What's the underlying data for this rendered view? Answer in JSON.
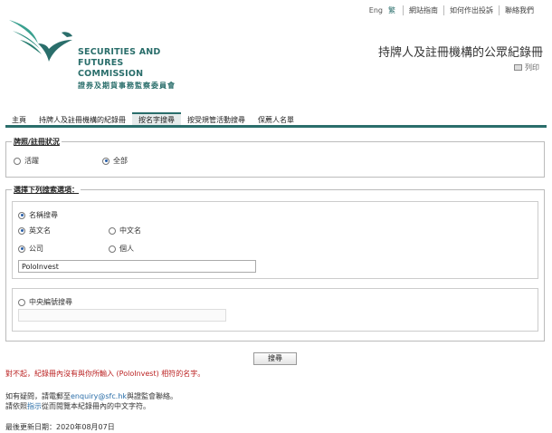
{
  "topnav": {
    "lang_en": "Eng",
    "lang_tc": "繁",
    "links": [
      "網站指南",
      "如何作出投訴",
      "聯絡我們"
    ]
  },
  "logo": {
    "line1": "SECURITIES AND",
    "line2": "FUTURES COMMISSION",
    "zh": "證券及期貨事務監察委員會"
  },
  "page_title": "持牌人及註冊機構的公眾紀錄冊",
  "print_label": "列印",
  "tabs": [
    {
      "label": "主頁",
      "active": false
    },
    {
      "label": "持牌人及註冊機構的紀錄冊",
      "active": false
    },
    {
      "label": "按名字搜尋",
      "active": true
    },
    {
      "label": "按受規管活動搜尋",
      "active": false
    },
    {
      "label": "保薦人名單",
      "active": false
    }
  ],
  "license_status": {
    "legend": "牌照/註冊狀況",
    "options": [
      {
        "label": "活躍",
        "selected": false
      },
      {
        "label": "全部",
        "selected": true
      }
    ]
  },
  "search_options": {
    "legend": "選擇下列搜索選項：",
    "name_search": {
      "label": "名稱搜尋",
      "selected": true
    },
    "lang_options": [
      {
        "label": "英文名",
        "selected": true
      },
      {
        "label": "中文名",
        "selected": false
      }
    ],
    "type_options": [
      {
        "label": "公司",
        "selected": true
      },
      {
        "label": "個人",
        "selected": false
      }
    ],
    "name_value": "PoloInvest",
    "ce_search": {
      "label": "中央編號搜尋",
      "selected": false
    },
    "ce_value": ""
  },
  "search_button": "搜尋",
  "error_message": "對不起，紀錄冊內沒有與你所輸入 (PoloInvest) 相符的名字。",
  "help": {
    "prefix": "如有疑問，請電郵至",
    "email": "enquiry@sfc.hk",
    "suffix": "與證監會聯絡。",
    "line2_prefix": "請依照",
    "line2_link": "指示",
    "line2_suffix": "從而閱覽本紀錄冊內的中文字符。"
  },
  "last_updated": "最後更新日期：2020年08月07日",
  "colors": {
    "brand": "#2a6e6b",
    "error": "#b22222",
    "link": "#2a6ea8"
  }
}
